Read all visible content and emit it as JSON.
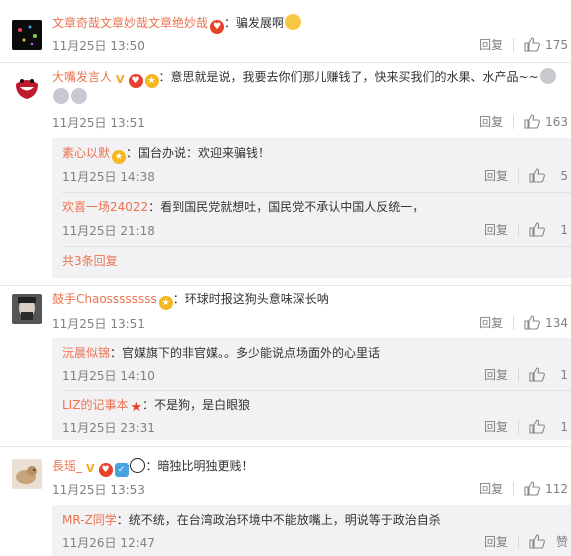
{
  "comments": [
    {
      "user": "文章奇哉文章妙哉文章绝妙哉",
      "text": "：骗发展啊",
      "time": "11月25日 13:50",
      "reply": "回复",
      "likes": "175"
    },
    {
      "user": "大嘴发言人",
      "text": "：意思就是说，我要去你们那儿赚钱了，快来买我们的水果、水产品~~",
      "time": "11月25日 13:51",
      "reply": "回复",
      "likes": "163",
      "replies": [
        {
          "user": "素心以默",
          "text": "：国台办说：欢迎来骗钱！",
          "time": "11月25日 14:38",
          "reply": "回复",
          "likes": "5"
        },
        {
          "user": "欢喜一场24022",
          "text": "：看到国民党就想吐，国民党不承认中国人反统一，",
          "time": "11月25日 21:18",
          "reply": "回复",
          "likes": "1"
        }
      ],
      "more": "共3条回复"
    },
    {
      "user": "鼓手Chaossssssss",
      "text": "：环球时报这狗头意味深长呐",
      "time": "11月25日 13:51",
      "reply": "回复",
      "likes": "134",
      "replies": [
        {
          "user": "沅晨似锦",
          "text": "：官媒旗下的非官媒。。多少能说点场面外的心里话",
          "time": "11月25日 14:10",
          "reply": "回复",
          "likes": "1"
        },
        {
          "user": "LIZ的记事本",
          "text": "：不是狗，是白眼狼",
          "time": "11月25日 23:31",
          "reply": "回复",
          "likes": "1"
        }
      ]
    },
    {
      "user": "長瑶_",
      "text": "：暗独比明独更贱！",
      "time": "11月25日 13:53",
      "reply": "回复",
      "likes": "112",
      "replies": [
        {
          "user": "MR-Z同学",
          "text": "：统不统，在台湾政治环境中不能放嘴上，明说等于政治自杀",
          "time": "11月26日 12:47",
          "reply": "回复",
          "likes": "赞"
        }
      ]
    }
  ],
  "colors": {
    "username": "#eb7350",
    "text": "#333333",
    "meta": "#808080",
    "sub_bg": "#f2f2f5"
  },
  "icons": {
    "like": "thumbs-up-icon",
    "badge": "level-badge-icon",
    "verified": "vip-v-icon"
  }
}
